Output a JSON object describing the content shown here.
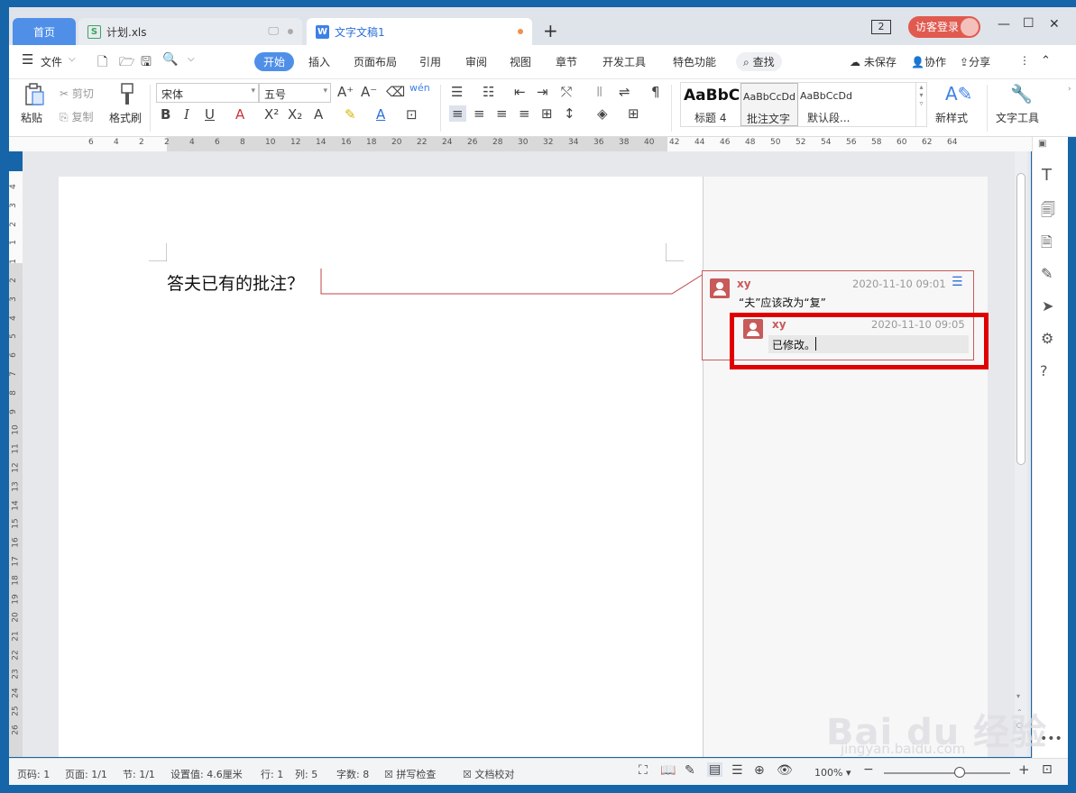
{
  "tabs": {
    "home": "首页",
    "xls": "计划.xls",
    "doc": "文字文稿1",
    "add": "+"
  },
  "window": {
    "counter": "2",
    "login": "访客登录",
    "minimize": "—",
    "maximize": "☐",
    "close": "✕"
  },
  "menu": {
    "file": "文件",
    "items": [
      "开始",
      "插入",
      "页面布局",
      "引用",
      "审阅",
      "视图",
      "章节",
      "开发工具",
      "特色功能"
    ],
    "search": "查找",
    "unsaved": "未保存",
    "collab": "协作",
    "share": "分享"
  },
  "ribbon": {
    "paste": "粘贴",
    "cut": "剪切",
    "copy": "复制",
    "format_painter": "格式刷",
    "font_name": "宋体",
    "font_size": "五号",
    "style1_preview": "AaBbC",
    "style1_name": "标题 4",
    "style2_preview": "AaBbCcDd",
    "style2_name": "批注文字",
    "style3_preview": "AaBbCcDd",
    "style3_name": "默认段...",
    "new_style": "新样式",
    "text_tools": "文字工具"
  },
  "ruler": {
    "top_ticks": [
      "6",
      "4",
      "2",
      "2",
      "4",
      "6",
      "8",
      "10",
      "12",
      "14",
      "16",
      "18",
      "20",
      "22",
      "24",
      "26",
      "28",
      "30",
      "32",
      "34",
      "36",
      "38",
      "40",
      "42",
      "44",
      "46",
      "48",
      "50",
      "52",
      "54",
      "56",
      "58",
      "60",
      "62",
      "64"
    ],
    "left_ticks": [
      "4",
      "3",
      "2",
      "1",
      "1",
      "2",
      "3",
      "4",
      "5",
      "6",
      "7",
      "8",
      "9",
      "10",
      "11",
      "12",
      "13",
      "14",
      "15",
      "16",
      "17",
      "18",
      "19",
      "20",
      "21",
      "22",
      "23",
      "24",
      "25",
      "26"
    ]
  },
  "document": {
    "text": "答夫已有的批注？"
  },
  "comments": [
    {
      "author": "xy",
      "time": "2020-11-10 09:01",
      "text": "“夫”应该改为“复”"
    },
    {
      "author": "xy",
      "time": "2020-11-10 09:05",
      "text": "已修改。"
    }
  ],
  "status": {
    "page_no": "页码: 1",
    "pages": "页面: 1/1",
    "section": "节: 1/1",
    "setting": "设置值: 4.6厘米",
    "row": "行: 1",
    "col": "列: 5",
    "words": "字数: 8",
    "spell": "拼写检查",
    "proof": "文档校对",
    "zoom": "100%",
    "zoom_level": 0.6
  },
  "watermark": {
    "brand": "Bai du 经验",
    "url": "jingyan.baidu.com"
  },
  "colors": {
    "accent": "#4f8fe8",
    "comment": "#c85a5a",
    "highlight": "#e00000"
  }
}
